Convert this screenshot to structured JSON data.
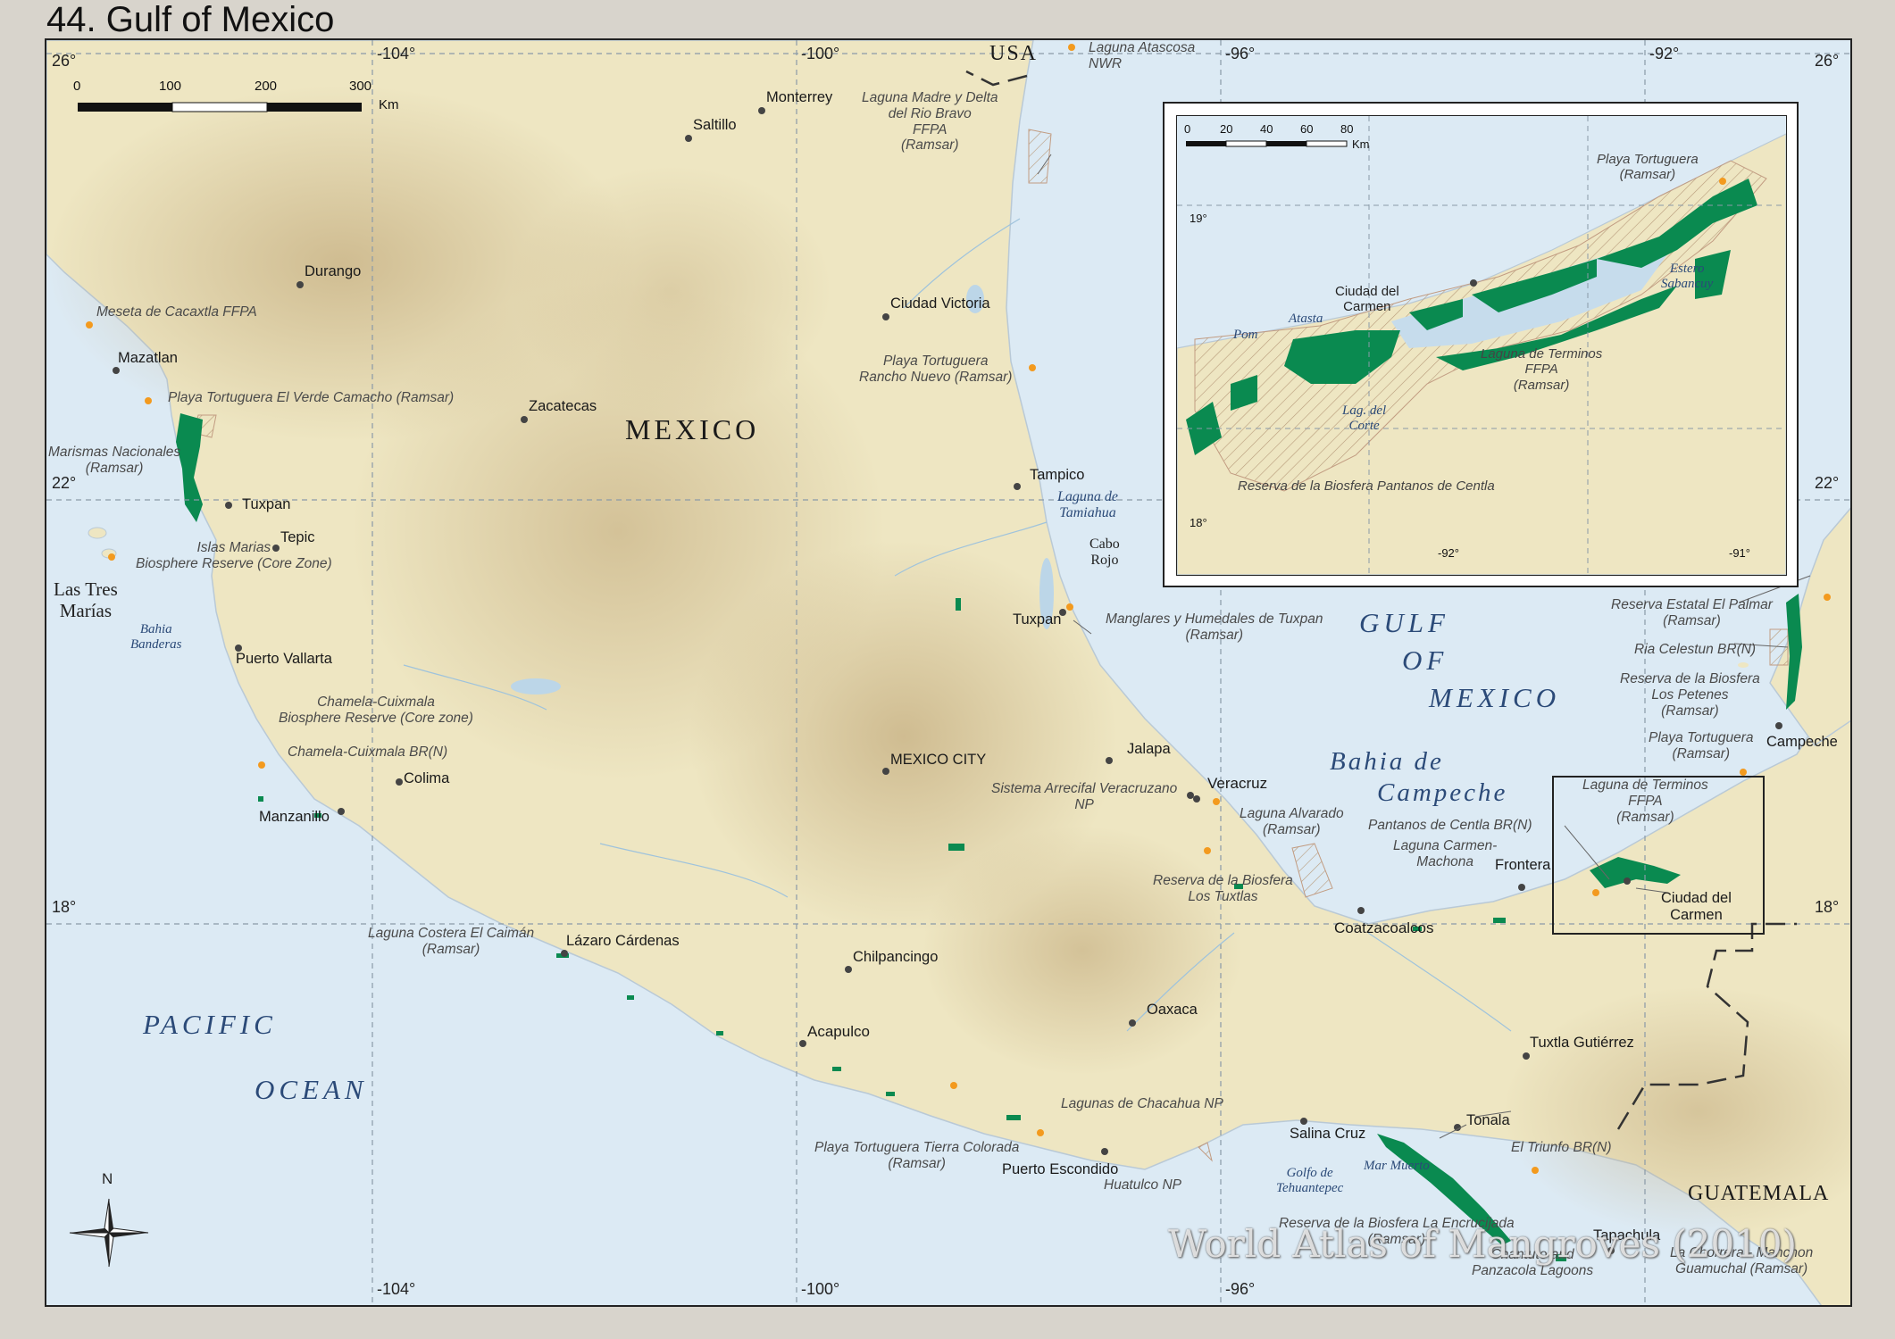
{
  "title": "44. Gulf of Mexico",
  "colors": {
    "ocean": "#dceaf4",
    "land": "#eee7c4",
    "highland": "#cdb98f",
    "mangrove": "#0a8a50",
    "site_dot": "#f39a1e",
    "grid": "#8a9aa8"
  },
  "scale": {
    "ticks": [
      "0",
      "100",
      "200",
      "300"
    ],
    "unit": "Km"
  },
  "graticule": {
    "top": [
      "-104°",
      "-100°",
      "-96°",
      "-92°"
    ],
    "bottom": [
      "-104°",
      "-100°",
      "-96°"
    ],
    "left": [
      "26°",
      "22°",
      "18°"
    ],
    "right": [
      "26°",
      "22°",
      "18°"
    ]
  },
  "regions": {
    "mexico": "MEXICO",
    "usa": "USA",
    "guatemala": "GUATEMALA",
    "pacific_1": "PACIFIC",
    "pacific_2": "OCEAN",
    "gulf_1": "GULF",
    "gulf_2": "OF",
    "gulf_3": "MEXICO",
    "bahia_1": "Bahia de",
    "bahia_2": "Campeche"
  },
  "geo": {
    "tres_marias": "Las Tres\nMarías",
    "bahia_banderas": "Bahia\nBanderas",
    "cabo_rojo": "Cabo\nRojo",
    "laguna_tamiahua": "Laguna de\nTamiahua",
    "golfo_tehuantepec": "Golfo de\nTehuantepec",
    "mar_muerto": "Mar Muerto"
  },
  "cities": {
    "monterrey": "Monterrey",
    "saltillo": "Saltillo",
    "durango": "Durango",
    "mazatlan": "Mazatlan",
    "zacatecas": "Zacatecas",
    "ciudad_victoria": "Ciudad Victoria",
    "tuxpan_w": "Tuxpan",
    "tepic": "Tepic",
    "puerto_vallarta": "Puerto Vallarta",
    "tampico": "Tampico",
    "tuxpan_e": "Tuxpan",
    "colima": "Colima",
    "manzanillo": "Manzanillo",
    "mexico_city": "MEXICO CITY",
    "jalapa": "Jalapa",
    "veracruz": "Veracruz",
    "lazaro_cardenas": "Lázaro Cárdenas",
    "chilpancingo": "Chilpancingo",
    "acapulco": "Acapulco",
    "oaxaca": "Oaxaca",
    "coatzacoalcos": "Coatzacoalcos",
    "frontera": "Frontera",
    "ciudad_del_carmen": "Ciudad del\nCarmen",
    "campeche": "Campeche",
    "tuxtla": "Tuxtla Gutiérrez",
    "salina_cruz": "Salina Cruz",
    "tonala": "Tonala",
    "puerto_escondido": "Puerto Escondido",
    "tapachula": "Tapachula"
  },
  "sites": {
    "laguna_atascosa": "Laguna Atascosa\nNWR",
    "laguna_madre": "Laguna Madre y Delta\ndel Rio Bravo\nFFPA\n(Ramsar)",
    "meseta_cacaxtla": "Meseta de Cacaxtla FFPA",
    "playa_verde": "Playa Tortuguera El Verde Camacho (Ramsar)",
    "marismas": "Marismas Nacionales\n(Ramsar)",
    "playa_rancho_nuevo": "Playa Tortuguera\nRancho Nuevo (Ramsar)",
    "islas_marias": "Islas Marias\nBiosphere Reserve (Core Zone)",
    "manglares_tuxpan": "Manglares y Humedales de Tuxpan\n(Ramsar)",
    "chamela_core": "Chamela-Cuixmala\nBiosphere Reserve (Core zone)",
    "chamela_br": "Chamela-Cuixmala BR(N)",
    "arrecifal": "Sistema Arrecifal Veracruzano\nNP",
    "laguna_alvarado": "Laguna Alvarado\n(Ramsar)",
    "los_tuxtlas": "Reserva de la Biosfera\nLos Tuxtlas",
    "laguna_caiman": "Laguna Costera El Caimán\n(Ramsar)",
    "laguna_carmen": "Laguna Carmen-\nMachona",
    "pantanos_centla": "Pantanos de Centla BR(N)",
    "laguna_terminos": "Laguna de Terminos\nFFPA\n(Ramsar)",
    "el_palmar": "Reserva Estatal El Palmar\n(Ramsar)",
    "ria_celestun": "Ria Celestun BR(N)",
    "los_petenes": "Reserva de la Biosfera\nLos Petenes\n(Ramsar)",
    "playa_campeche": "Playa Tortuguera\n(Ramsar)",
    "chacahua": "Lagunas de Chacahua NP",
    "tierra_colorada": "Playa Tortuguera Tierra Colorada\n(Ramsar)",
    "huatulco": "Huatulco NP",
    "el_triunfo": "El Triunfo BR(N)",
    "encrucijada": "Reserva de la Biosfera La Encrucijada\n(Ramsar)",
    "chantuto": "Chantuto and\nPanzacola Lagoons",
    "la_chorrera": "La Chorrera - Manchon\nGuamuchal (Ramsar)"
  },
  "inset": {
    "scale_ticks": [
      "0",
      "20",
      "40",
      "60",
      "80"
    ],
    "scale_unit": "Km",
    "lat_19": "19°",
    "lat_18": "18°",
    "lon_92": "-92°",
    "lon_91": "-91°",
    "playa_tortuguera": "Playa Tortuguera\n(Ramsar)",
    "estero_sabancuy": "Estero\nSabancuy",
    "ciudad_del_carmen": "Ciudad del\nCarmen",
    "atasta": "Atasta",
    "pom": "Pom",
    "laguna_terminos": "Laguna de Terminos\nFFPA\n(Ramsar)",
    "lag_del_corte": "Lag. del\nCorte",
    "centla": "Reserva de la Biosfera Pantanos de Centla"
  },
  "compass": "N",
  "watermark": "World Atlas of Mangroves (2010)"
}
